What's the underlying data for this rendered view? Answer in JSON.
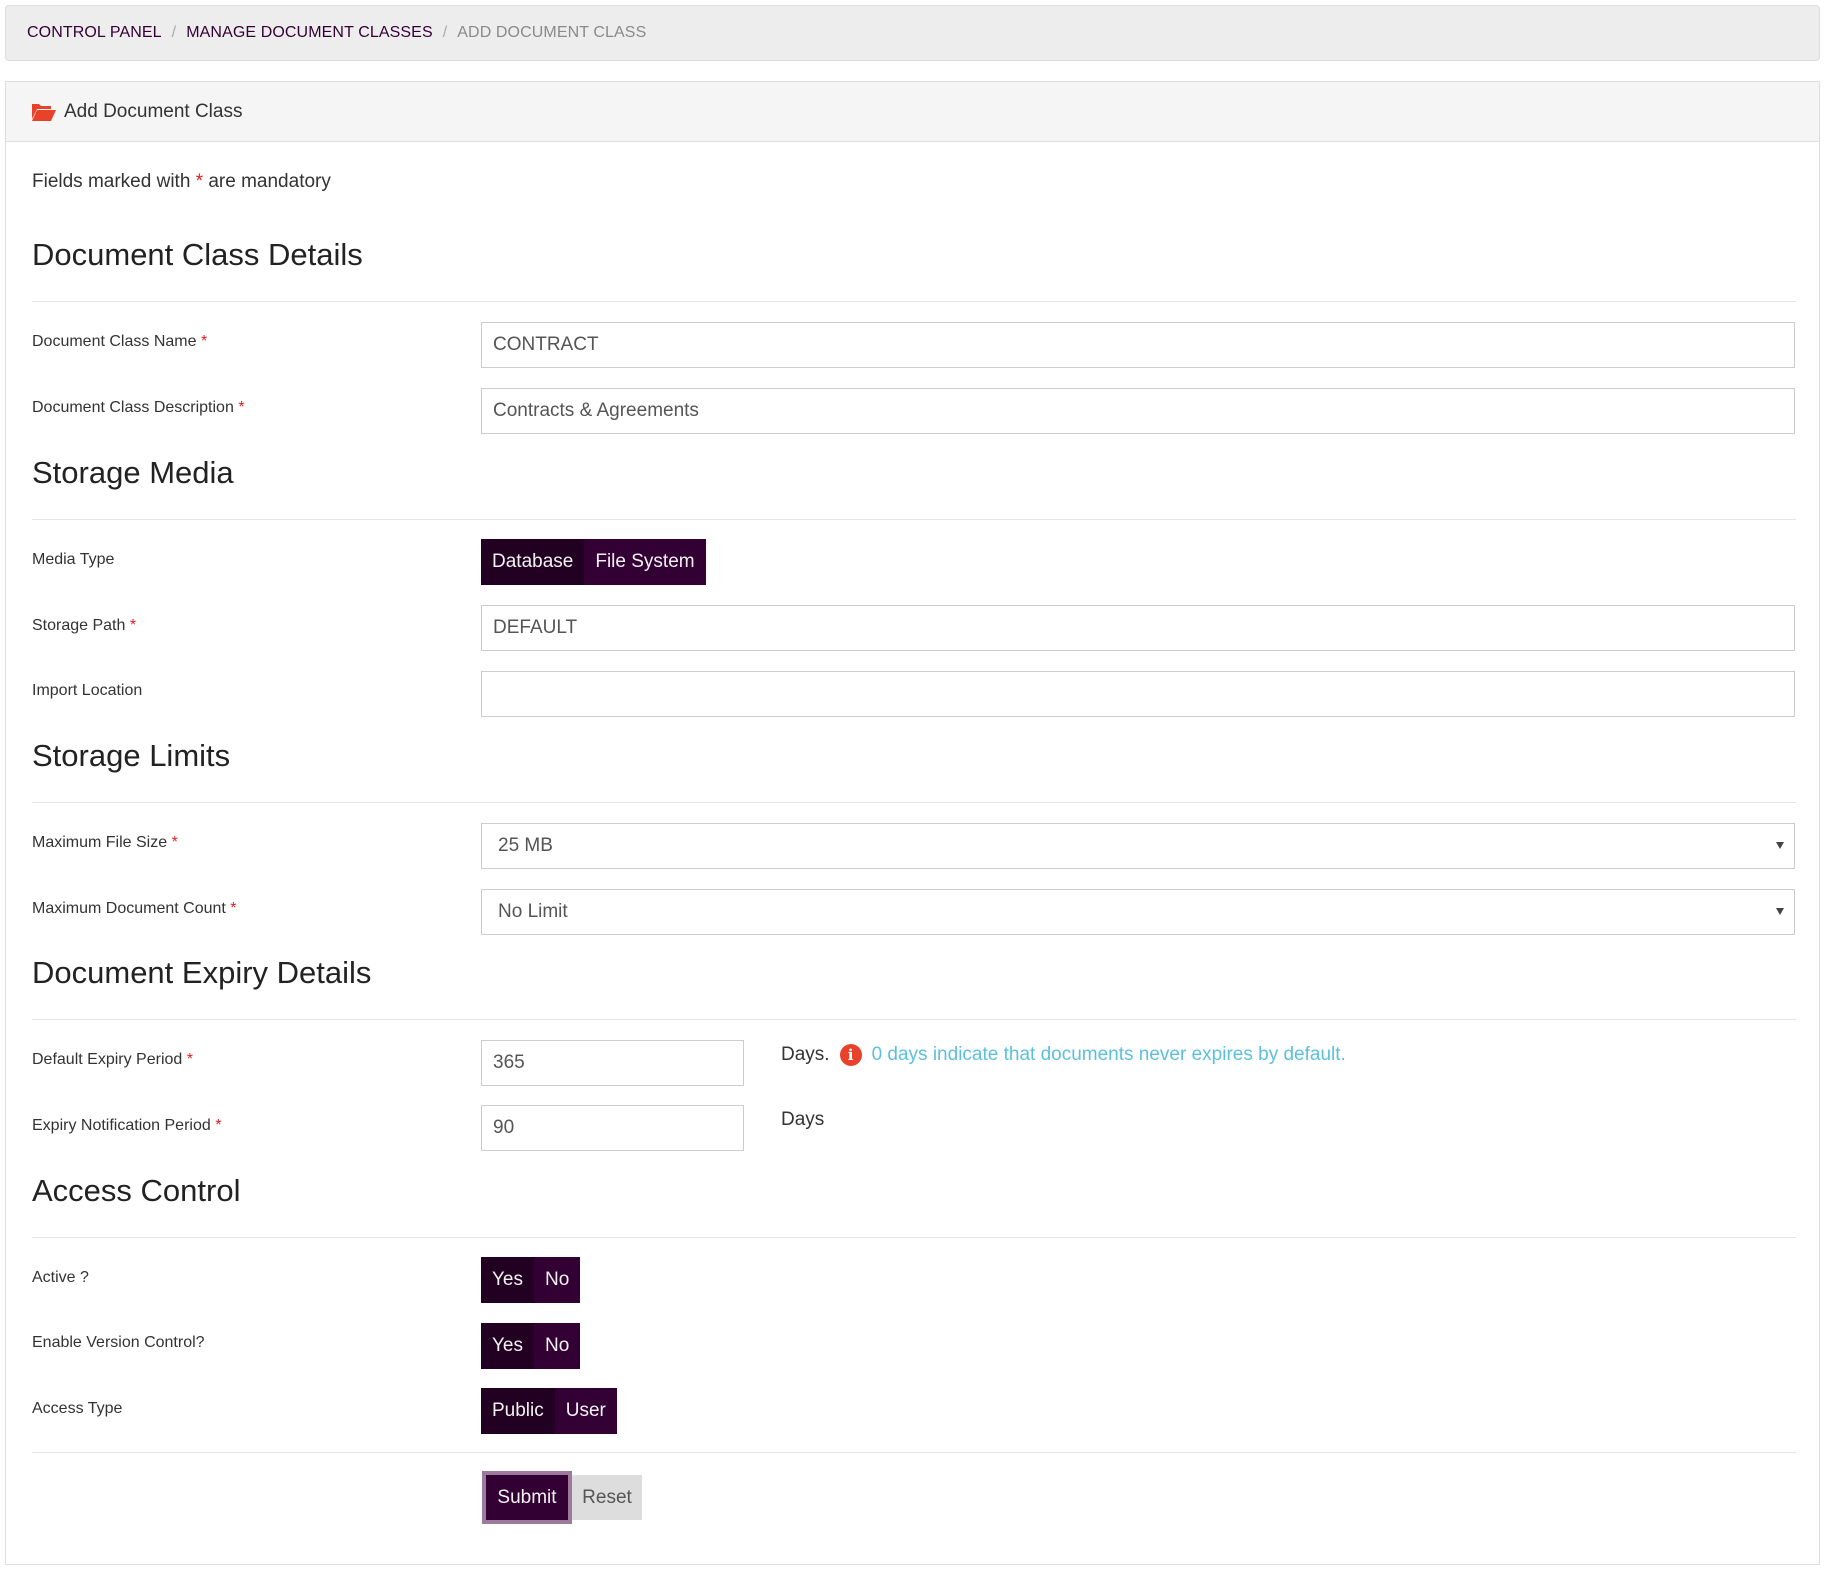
{
  "breadcrumb": {
    "items": [
      {
        "label": "CONTROL PANEL",
        "current": false
      },
      {
        "label": "MANAGE DOCUMENT CLASSES",
        "current": false
      },
      {
        "label": "ADD DOCUMENT CLASS",
        "current": true
      }
    ],
    "separator": "/"
  },
  "panel": {
    "title": "Add Document Class",
    "icon": "folder-open-icon"
  },
  "mandatory_note": {
    "prefix": "Fields marked with",
    "asterisk": "*",
    "suffix": "are mandatory"
  },
  "sections": {
    "details": {
      "title": "Document Class Details",
      "name": {
        "label": "Document Class Name",
        "required": "*",
        "value": "CONTRACT"
      },
      "description": {
        "label": "Document Class Description",
        "required": "*",
        "value": "Contracts & Agreements"
      }
    },
    "storage_media": {
      "title": "Storage Media",
      "media_type": {
        "label": "Media Type",
        "options": [
          "Database",
          "File System"
        ],
        "selected": "Database"
      },
      "storage_path": {
        "label": "Storage Path",
        "required": "*",
        "value": "DEFAULT"
      },
      "import_location": {
        "label": "Import Location",
        "value": ""
      }
    },
    "storage_limits": {
      "title": "Storage Limits",
      "max_file_size": {
        "label": "Maximum File Size",
        "required": "*",
        "selected": "25 MB"
      },
      "max_doc_count": {
        "label": "Maximum Document Count",
        "required": "*",
        "selected": "No Limit"
      }
    },
    "expiry": {
      "title": "Document Expiry Details",
      "default_period": {
        "label": "Default Expiry Period",
        "required": "*",
        "value": "365",
        "unit": "Days.",
        "help": "0 days indicate that documents never expires by default.",
        "help_icon": "info-icon"
      },
      "notification_period": {
        "label": "Expiry Notification Period",
        "required": "*",
        "value": "90",
        "unit": "Days"
      }
    },
    "access": {
      "title": "Access Control",
      "active": {
        "label": "Active ?",
        "options": [
          "Yes",
          "No"
        ],
        "selected": "Yes"
      },
      "version_control": {
        "label": "Enable Version Control?",
        "options": [
          "Yes",
          "No"
        ],
        "selected": "Yes"
      },
      "access_type": {
        "label": "Access Type",
        "options": [
          "Public",
          "User"
        ],
        "selected": "Public"
      }
    }
  },
  "actions": {
    "submit_label": "Submit",
    "reset_label": "Reset"
  },
  "colors": {
    "primary": "#330033",
    "primary_active": "#220022",
    "accent_icon": "#e8422b",
    "help_text": "#5bc0de",
    "required": "#e02020"
  }
}
